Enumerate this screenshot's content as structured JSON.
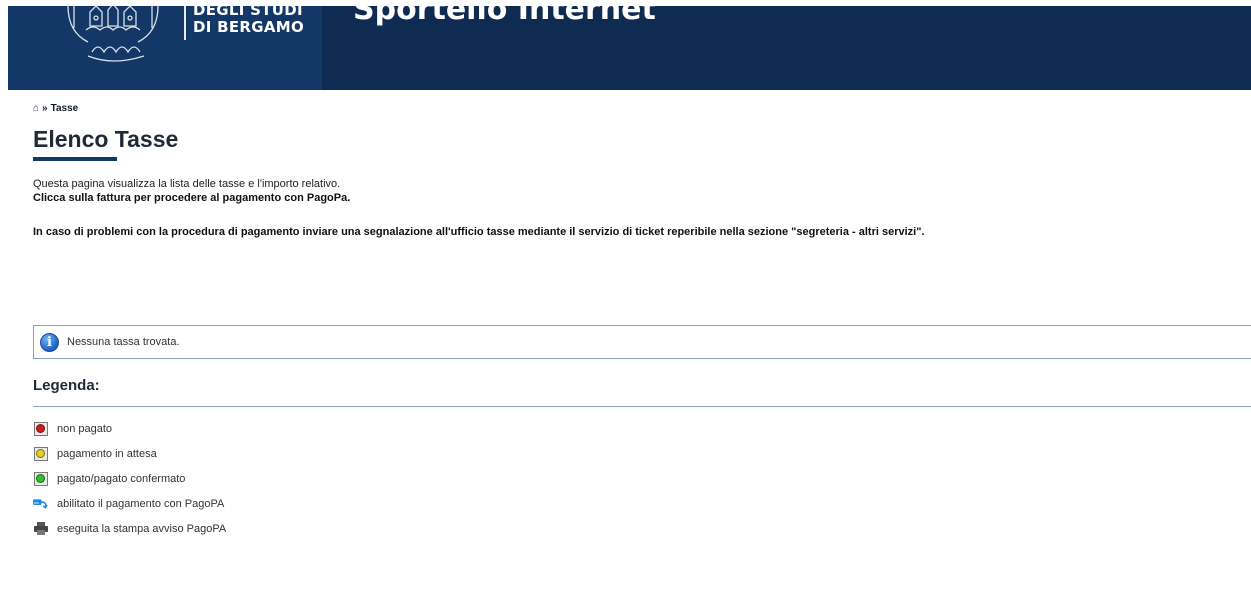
{
  "header": {
    "logo_line1": "DEGLI STUDI",
    "logo_line2": "DI BERGAMO",
    "site_title": "Sportello Internet",
    "bg_color": "#0f2b52"
  },
  "breadcrumb": {
    "home_icon": "home-icon",
    "separator": "»",
    "current": "Tasse"
  },
  "page": {
    "title": "Elenco Tasse",
    "intro": "Questa pagina visualizza la lista delle tasse e l'importo relativo.",
    "instruction": "Clicca sulla fattura per procedere al pagamento con PagoPa.",
    "warning": "In caso di problemi con la procedura di pagamento inviare una segnalazione all'ufficio tasse mediante il servizio di ticket reperibile nella sezione \"segreteria - altri servizi\"."
  },
  "info": {
    "icon": "info-icon",
    "message": "Nessuna tassa trovata."
  },
  "legend": {
    "title": "Legenda:",
    "items": [
      {
        "icon": "red-status-icon",
        "label": "non pagato",
        "color": "#d11a1a"
      },
      {
        "icon": "yellow-status-icon",
        "label": "pagamento in attesa",
        "color": "#e3d21c"
      },
      {
        "icon": "green-status-icon",
        "label": "pagato/pagato confermato",
        "color": "#2fbf2f"
      },
      {
        "icon": "pagopa-icon",
        "label": "abilitato il pagamento con PagoPA",
        "color": "#1e88e5"
      },
      {
        "icon": "printer-icon",
        "label": "eseguita la stampa avviso PagoPA",
        "color": "#444444"
      }
    ]
  }
}
